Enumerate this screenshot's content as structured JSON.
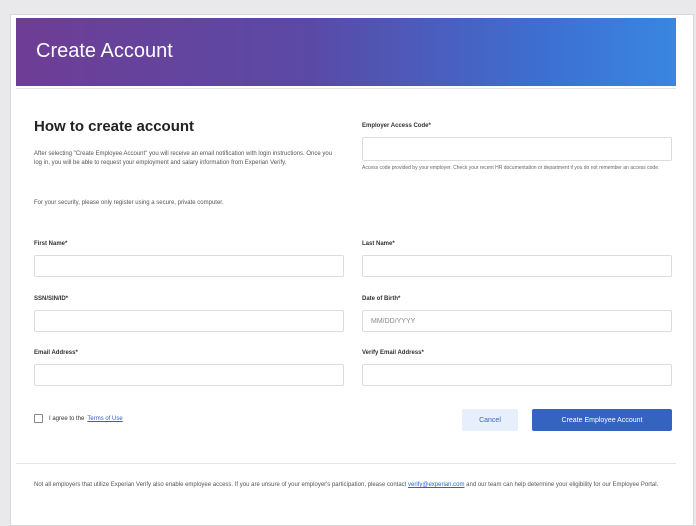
{
  "banner": {
    "title": "Create Account"
  },
  "instructions": {
    "title": "How to create account",
    "paragraph1": "After selecting \"Create Employee Account\" you will receive an email notification with login instructions. Once you log in, you will be able to request your employment and salary information from Experian Verify.",
    "paragraph2": "For your security, please only register using a secure, private computer."
  },
  "form": {
    "employer_code": {
      "label": "Employer Access Code*",
      "value": "",
      "placeholder": ""
    },
    "employer_code_hint": "Access code provided by your employer. Check your recent HR documentation or department if you do not remember an access code.",
    "first_name": {
      "label": "First Name*",
      "value": "",
      "placeholder": ""
    },
    "last_name": {
      "label": "Last Name*",
      "value": "",
      "placeholder": ""
    },
    "ssn": {
      "label": "SSN/SIN/ID*",
      "value": "",
      "placeholder": ""
    },
    "dob": {
      "label": "Date of Birth*",
      "value": "",
      "placeholder": "MM/DD/YYYY"
    },
    "email": {
      "label": "Email Address*",
      "value": "",
      "placeholder": ""
    },
    "verify_email": {
      "label": "Verify Email Address*",
      "value": "",
      "placeholder": ""
    }
  },
  "terms": {
    "prefix": "I agree to the",
    "link": "Terms of Use"
  },
  "buttons": {
    "cancel": "Cancel",
    "create": "Create Employee Account"
  },
  "footer": {
    "text_before": "Not all employers that utilize Experian Verify also enable employee access. If you are unsure of your employer's participation, please contact",
    "link": "verify@experian.com",
    "text_after": "and our team can help determine your eligibility for our Employee Portal."
  },
  "colors": {
    "banner_start": "#6e3d94",
    "banner_end": "#3a86e0",
    "primary": "#3563c2",
    "link": "#2f5fd0"
  }
}
